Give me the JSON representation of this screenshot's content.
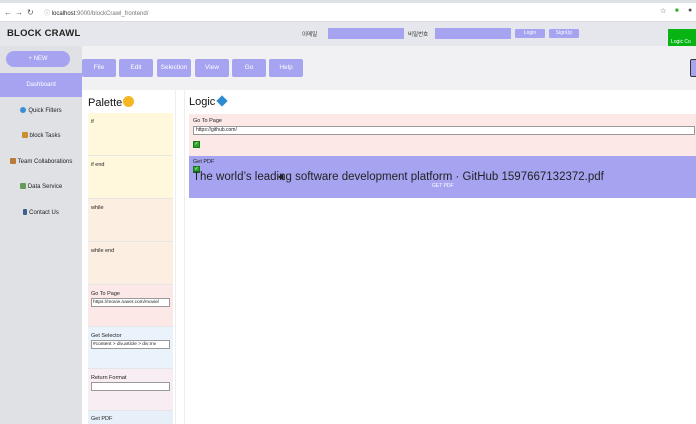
{
  "browser": {
    "url_host": "localhost",
    "url_path": ":9000/blockCrawl_frontend/"
  },
  "header": {
    "brand": "BLOCK CRAWL",
    "email_label": "이메일",
    "password_label": "비밀번호",
    "email_value": "",
    "password_value": "",
    "login_label": "Login",
    "signup_label": "SignUp",
    "notice": "Logic Co"
  },
  "sidebar": {
    "new_label": "+ NEW",
    "items": [
      {
        "label": "Dashboard",
        "icon": "dashboard-icon"
      },
      {
        "label": "Quick Filters",
        "icon": "globe-icon"
      },
      {
        "label": "block Tasks",
        "icon": "hourglass-icon"
      },
      {
        "label": "Team Collaborations",
        "icon": "team-icon"
      },
      {
        "label": "Data Service",
        "icon": "chart-icon"
      },
      {
        "label": "Contact Us",
        "icon": "phone-icon"
      }
    ]
  },
  "toolbar": {
    "buttons": [
      "File",
      "Edit",
      "Selection",
      "View",
      "Go",
      "Help"
    ]
  },
  "palette": {
    "title": "Palette",
    "cards": [
      {
        "title": "if",
        "input": null
      },
      {
        "title": "if end",
        "input": null
      },
      {
        "title": "while",
        "input": null
      },
      {
        "title": "while end",
        "input": null
      },
      {
        "title": "Go To Page",
        "input": "https://movie.naver.com/movie/"
      },
      {
        "title": "Get Selector",
        "input": "#content > div.article > div:mv"
      },
      {
        "title": "Return Format",
        "input": ""
      },
      {
        "title": "Get PDF",
        "input": null
      }
    ]
  },
  "logic": {
    "title": "Logic",
    "block1": {
      "title": "Go To Page",
      "input": "https://github.com/"
    },
    "block2": {
      "title": "Get PDF",
      "filename": "The world’s leading software development platform · GitHub  1597667132372.pdf",
      "sub": "GET PDF"
    }
  },
  "colors": {
    "accent": "#a6a3f1",
    "sidebar_bg": "#dfe1e5",
    "green": "#08b314"
  }
}
